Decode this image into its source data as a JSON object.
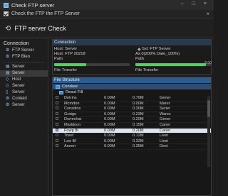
{
  "window": {
    "title": "Check FTP server",
    "controls": "– □ ×"
  },
  "subbar": {
    "text": "Check the FTP the FTP Server",
    "close": "×"
  },
  "header": {
    "icon": "⟲",
    "title": "FTP server Check"
  },
  "sidebar": {
    "heading": "Connection",
    "items": [
      {
        "icon": "⚙",
        "label": "FTP Server"
      },
      {
        "icon": "⚙",
        "label": "FTP Bleo"
      },
      {
        "icon": "▤",
        "label": "Server"
      },
      {
        "icon": "▤",
        "label": "Server"
      },
      {
        "icon": "◇",
        "label": "Host"
      },
      {
        "icon": "◇",
        "label": "Server"
      },
      {
        "icon": "▯",
        "label": "Server"
      },
      {
        "icon": "⚙",
        "label": "Conteld"
      },
      {
        "icon": "⚙",
        "label": "Server"
      }
    ]
  },
  "connection": {
    "heading": "Connection",
    "left": {
      "host": "Host: Server",
      "host2": "Host: FTP 20218",
      "path": "Path",
      "progress": 0.42,
      "footer": "File Transfer"
    },
    "right": {
      "ssl": "Ssl: FTP Server",
      "ax": "Ax.0(200% Date_100%)",
      "path": "Path",
      "progress": 0.93,
      "value": "6.00",
      "footer": "File Transfer"
    }
  },
  "files": {
    "heading": "File Structure",
    "root": "Conduer",
    "folder": "Resut Fill",
    "rows": [
      {
        "name": "Detrins",
        "a": "0.00M",
        "b": "0.70M",
        "c": "Gener"
      },
      {
        "name": "Mcmdon",
        "a": "0.00M",
        "b": "0.00M",
        "c": "Marer"
      },
      {
        "name": "Conaitins",
        "a": "0.00M",
        "b": "0.30M",
        "c": "Serier"
      },
      {
        "name": "Gratgo",
        "a": "0.00M",
        "b": "0.23M",
        "c": "Warec"
      },
      {
        "name": "Dermchar",
        "a": "0.00M",
        "b": "0.20M",
        "c": "Gener"
      },
      {
        "name": "Maddoon",
        "a": "0.00M",
        "b": "0.15M",
        "c": "Caner"
      },
      {
        "name": "Fowp 8t",
        "a": "0.00M",
        "b": "0.20M",
        "c": "Caner",
        "sel": true
      },
      {
        "name": "Tosel",
        "a": "0.00M",
        "b": "0.12M",
        "c": "Llest"
      },
      {
        "name": "Lsw fill",
        "a": "0.00M",
        "b": "0.32M",
        "c": "Llest"
      },
      {
        "name": "Aeeen",
        "a": "0.00M",
        "b": "0.35M",
        "c": "Dest"
      }
    ]
  }
}
